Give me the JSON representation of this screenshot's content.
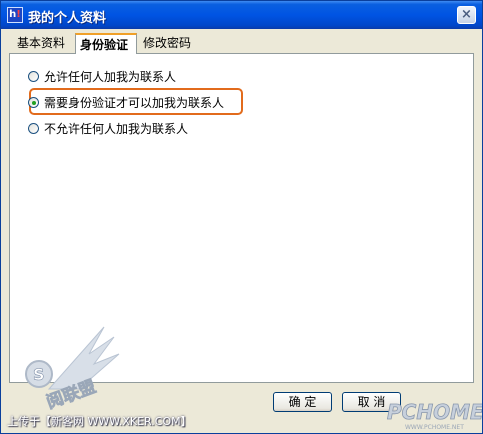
{
  "window": {
    "title": "我的个人资料",
    "app_icon": "h!",
    "close_label": "×"
  },
  "tabs": [
    {
      "label": "基本资料"
    },
    {
      "label": "身份验证",
      "active": true
    },
    {
      "label": "修改密码"
    }
  ],
  "options": [
    {
      "label": "允许任何人加我为联系人",
      "selected": false
    },
    {
      "label": "需要身份验证才可以加我为联系人",
      "selected": true
    },
    {
      "label": "不允许任何人加我为联系人",
      "selected": false
    }
  ],
  "buttons": {
    "ok": "确 定",
    "cancel": "取 消"
  },
  "watermark": {
    "upload": "上传于【新客网 WWW.XKER.COM】",
    "site_logo_text": "阅联盟",
    "site_logo_letter": "S",
    "pchome": "PCHOME",
    "pchome_url": "WWW.PCHOME.NET"
  },
  "colors": {
    "title_bar": "#0054e3",
    "highlight": "#e26b1c",
    "radio_dot": "#21a121"
  }
}
